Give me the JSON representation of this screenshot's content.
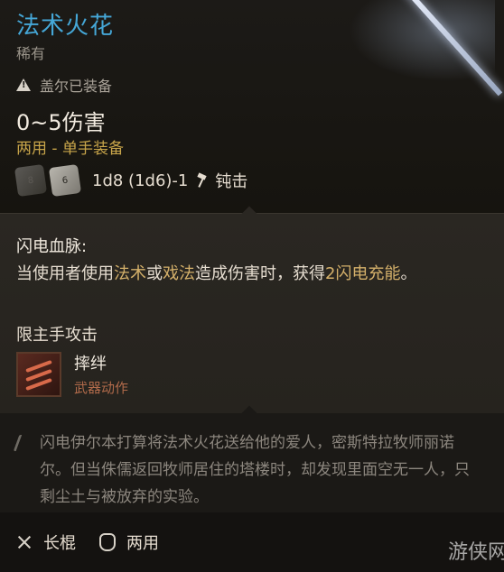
{
  "item": {
    "name": "法术火花",
    "rarity": "稀有",
    "equipped_by": "盖尔已装备",
    "damage": "0~5伤害",
    "hand_usage": "两用 - 单手装备",
    "dice_left_label": "8",
    "dice_right_label": "6",
    "dice_formula": "1d8 (1d6)-1",
    "damage_type": "钝击"
  },
  "passive": {
    "title": "闪电血脉:",
    "desc_part1": "当使用者使用",
    "desc_hl1": "法术",
    "desc_part2": "或",
    "desc_hl2": "戏法",
    "desc_part3": "造成伤害时，获得",
    "desc_hl3": "2闪电充能",
    "desc_part4": "。",
    "restriction": "限主手攻击"
  },
  "action": {
    "name": "摔绊",
    "type": "武器动作"
  },
  "lore": {
    "text": "闪电伊尔本打算将法术火花送给他的爱人，密斯特拉牧师丽诺尔。但当侏儒返回牧师居住的塔楼时，却发现里面空无一人，只剩尘土与被放弃的实验。"
  },
  "footer": {
    "weapon_type": "长棍",
    "handedness": "两用"
  },
  "watermark": "游侠网",
  "colors": {
    "title": "#45a7d7",
    "hand_usage": "#c8a54a",
    "highlight": "#d4b06a",
    "action_type": "#b06a4a"
  }
}
